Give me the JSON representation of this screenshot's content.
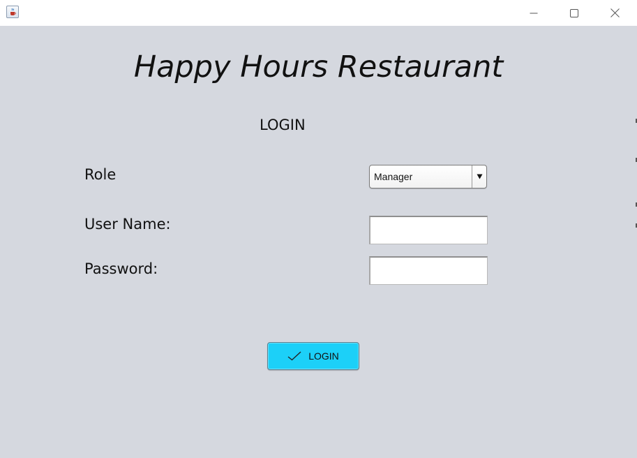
{
  "window": {
    "icon": "java-cup-icon",
    "controls": {
      "minimize": "minimize-icon",
      "maximize": "maximize-icon",
      "close": "close-icon"
    }
  },
  "header": {
    "title": "Happy Hours Restaurant",
    "subtitle": "LOGIN"
  },
  "form": {
    "role": {
      "label": "Role",
      "selected": "Manager"
    },
    "username": {
      "label": "User Name:",
      "value": ""
    },
    "password": {
      "label": "Password:",
      "value": ""
    },
    "submit": {
      "label": "LOGIN",
      "icon": "check-icon",
      "color": "#1cd0f8"
    }
  },
  "colors": {
    "background": "#d5d8df",
    "titlebar": "#ffffff"
  }
}
